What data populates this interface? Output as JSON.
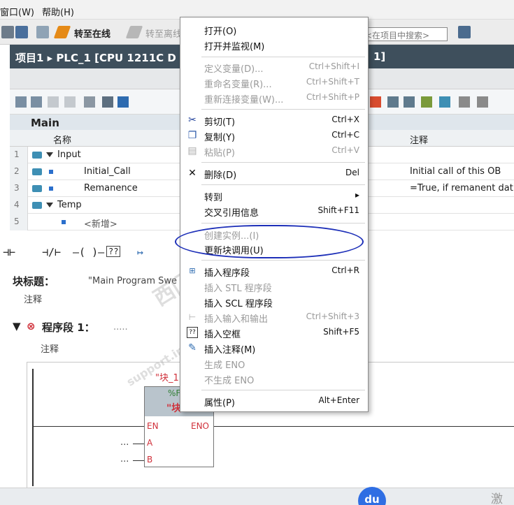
{
  "menubar": {
    "items": [
      "窗口(W)",
      "帮助(H)"
    ]
  },
  "toolbar": {
    "go_online": "转至在线",
    "go_offline": "转至离线",
    "search_placeholder": "<在项目中搜索>"
  },
  "project": {
    "breadcrumb": "项目1 ▸ PLC_1 [CPU 1211C D",
    "breadcrumb_right": "1]"
  },
  "block": {
    "name": "Main"
  },
  "interface_table": {
    "headers": {
      "name": "名称",
      "comment": "注释"
    },
    "rows": [
      {
        "num": "1",
        "name": "Input",
        "comment": ""
      },
      {
        "num": "2",
        "name": "Initial_Call",
        "comment": "Initial call of this OB"
      },
      {
        "num": "3",
        "name": "Remanence",
        "comment": "=True, if remanent dat"
      },
      {
        "num": "4",
        "name": "Temp",
        "comment": ""
      },
      {
        "num": "5",
        "name": "<新增>",
        "comment": ""
      }
    ]
  },
  "ladder_toolbar": {
    "symbols": [
      "⊣⊢",
      "⊣/⊢",
      "–( )–",
      "??",
      "↦"
    ]
  },
  "block_title": {
    "label": "块标题：",
    "value": "\"Main Program Swe",
    "comment": "注释"
  },
  "network": {
    "label": "程序段 1：",
    "dots": ".....",
    "comment": "注释",
    "fb_instance": "\"块_1",
    "fb_name": "\"块",
    "fb_sub": "%F",
    "pin_en": "EN",
    "pin_eno": "ENO",
    "pin_a": "A",
    "pin_b": "B",
    "pin_dash_a": "...",
    "pin_dash_b": "..."
  },
  "context_menu": {
    "items": [
      {
        "label": "打开(O)",
        "shortcut": "",
        "enabled": true
      },
      {
        "label": "打开并监视(M)",
        "shortcut": "",
        "enabled": true
      },
      {
        "label": "定义变量(D)...",
        "shortcut": "Ctrl+Shift+I",
        "enabled": false
      },
      {
        "label": "重命名变量(R)...",
        "shortcut": "Ctrl+Shift+T",
        "enabled": false
      },
      {
        "label": "重新连接变量(W)...",
        "shortcut": "Ctrl+Shift+P",
        "enabled": false
      },
      {
        "label": "剪切(T)",
        "shortcut": "Ctrl+X",
        "enabled": true
      },
      {
        "label": "复制(Y)",
        "shortcut": "Ctrl+C",
        "enabled": true
      },
      {
        "label": "粘贴(P)",
        "shortcut": "Ctrl+V",
        "enabled": false
      },
      {
        "label": "删除(D)",
        "shortcut": "Del",
        "enabled": true
      },
      {
        "label": "转到",
        "shortcut": "▸",
        "enabled": true
      },
      {
        "label": "交叉引用信息",
        "shortcut": "Shift+F11",
        "enabled": true
      },
      {
        "label": "创建实例...(I)",
        "shortcut": "",
        "enabled": false
      },
      {
        "label": "更新块调用(U)",
        "shortcut": "",
        "enabled": true
      },
      {
        "label": "插入程序段",
        "shortcut": "Ctrl+R",
        "enabled": true
      },
      {
        "label": "插入 STL 程序段",
        "shortcut": "",
        "enabled": false
      },
      {
        "label": "插入 SCL 程序段",
        "shortcut": "",
        "enabled": true
      },
      {
        "label": "插入输入和输出",
        "shortcut": "Ctrl+Shift+3",
        "enabled": false
      },
      {
        "label": "插入空框",
        "shortcut": "Shift+F5",
        "enabled": true
      },
      {
        "label": "插入注释(M)",
        "shortcut": "",
        "enabled": true
      },
      {
        "label": "生成 ENO",
        "shortcut": "",
        "enabled": false
      },
      {
        "label": "不生成 ENO",
        "shortcut": "",
        "enabled": false
      },
      {
        "label": "属性(P)",
        "shortcut": "Alt+Enter",
        "enabled": true
      }
    ]
  },
  "watermark": {
    "text1": "西门子技术论坛",
    "text2": "support.industry.siemens.com/cs"
  },
  "bottom": {
    "fab_label": "du",
    "right_text": "激"
  },
  "colors": {
    "header_bg": "#3e4f5c",
    "accent": "#2f6ee3",
    "annotation": "#1d2fb8",
    "error_red": "#d0303a"
  }
}
